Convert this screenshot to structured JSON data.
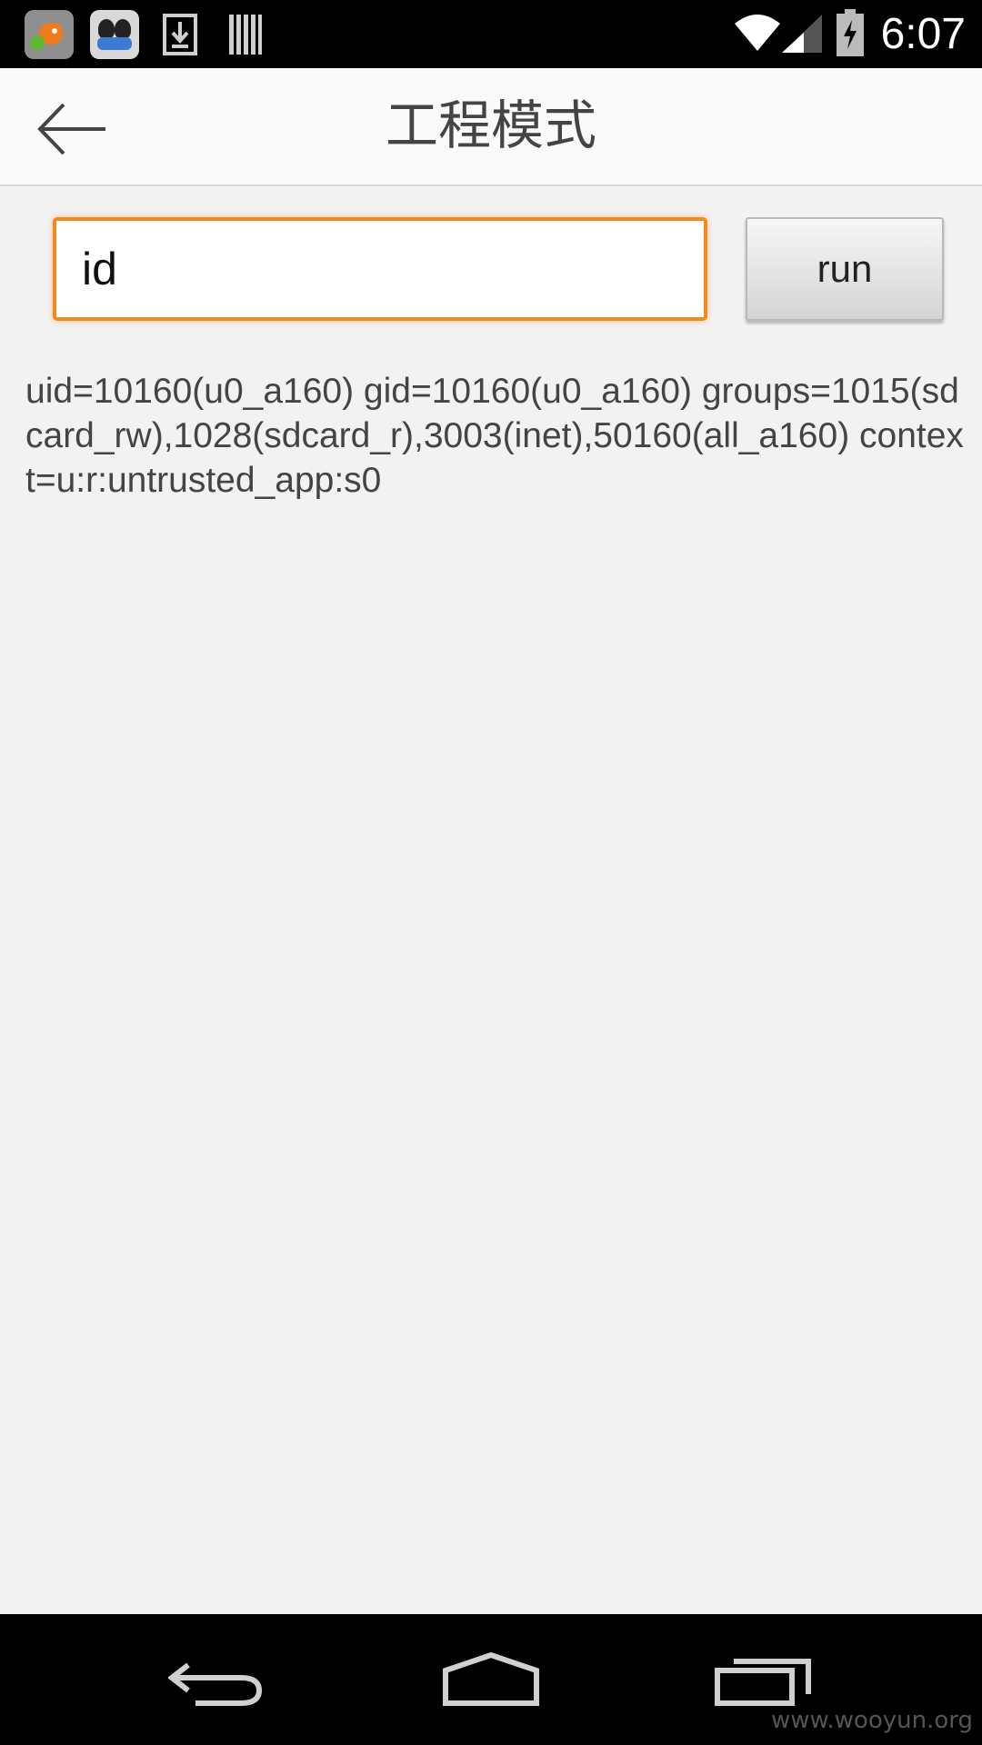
{
  "status_bar": {
    "time": "6:07",
    "notification_icons": [
      "fish-app-icon",
      "penguin-app-icon",
      "download-icon",
      "barcode-icon"
    ],
    "system_icons": [
      "wifi-icon",
      "signal-icon",
      "battery-charging-icon"
    ]
  },
  "action_bar": {
    "title": "工程模式",
    "back_icon": "back-arrow-icon"
  },
  "command": {
    "input_value": "id",
    "run_label": "run"
  },
  "output": {
    "text": "uid=10160(u0_a160) gid=10160(u0_a160) groups=1015(sdcard_rw),1028(sdcard_r),3003(inet),50160(all_a160) context=u:r:untrusted_app:s0"
  },
  "nav_bar": {
    "buttons": [
      "nav-back-icon",
      "nav-home-icon",
      "nav-recents-icon"
    ],
    "watermark": "www.wooyun.org"
  },
  "colors": {
    "accent": "#f28a1e",
    "background": "#f2f2f2",
    "action_bar": "#fafafa",
    "system_bars": "#000000"
  }
}
